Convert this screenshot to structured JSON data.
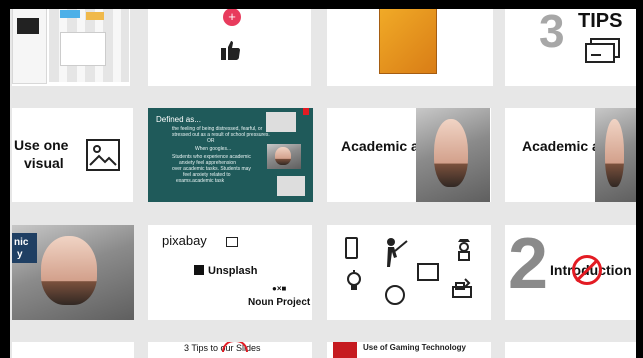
{
  "cards": {
    "c1": {
      "label": "Academic anxiety"
    },
    "c2": {
      "label": "Academic anxiety"
    },
    "use_one_visual": {
      "line1": "Use one",
      "line2": "visual"
    },
    "defined_as": {
      "title": "Defined as...",
      "line1": "the feeling of being distressed, fearful, or",
      "line2": "stressed out as a result of school pressures.",
      "line3": "OR",
      "line4": "When googles...",
      "line5": "Students who experience academic",
      "line6": "anxiety feel apprehension",
      "line7": "over academic tasks. Students may",
      "line8": "feel anxiety related to",
      "line9": "exams.academic task"
    },
    "logos": {
      "pixabay": "pixabay",
      "unsplash": "Unsplash",
      "noun": "Noun Project"
    },
    "tips3": {
      "number": "3",
      "word": "TIPS"
    },
    "intro": {
      "number": "2",
      "text": "Introduction"
    },
    "bottom": {
      "tips_slides": "3 Tips to        our Slides",
      "gaming": "Use of Gaming Technology"
    },
    "partial_left_text": {
      "t1": "nic",
      "t2": "y"
    }
  },
  "icons": {
    "thumb": "thumbs-up-icon",
    "plus": "plus-icon",
    "image": "image-icon",
    "phone": "phone-icon",
    "teacher": "teacher-icon",
    "book": "book-icon",
    "police": "police-icon",
    "idea": "lightbulb-icon",
    "face": "surprised-face-icon",
    "vote": "ballot-icon",
    "flower": "flower-icon",
    "no": "no-sign-icon"
  },
  "colors": {
    "accent": "#e83b5d",
    "dark": "#1f5a5a",
    "bg": "#e7e7e7",
    "red": "#e31b23"
  }
}
